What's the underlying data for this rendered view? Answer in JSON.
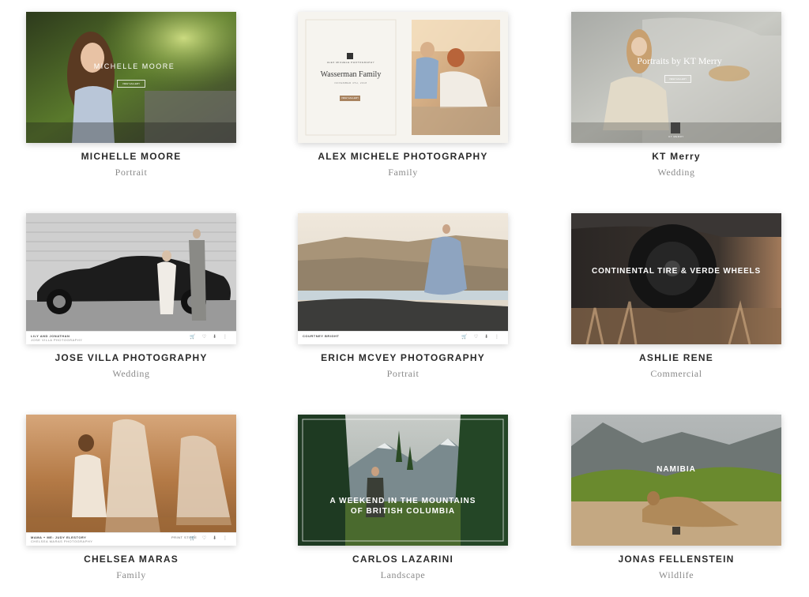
{
  "portfolios": [
    {
      "name": "MICHELLE MOORE",
      "category": "Portrait",
      "overlay_title": "MICHELLE MOORE",
      "overlay_button": "VIEW GALLERY"
    },
    {
      "name": "ALEX MICHELE PHOTOGRAPHY",
      "category": "Family",
      "overlay_brand": "ALEX MICHELE PHOTOGRAPHY",
      "overlay_title": "Wasserman Family",
      "overlay_date": "NOVEMBER 4TH, 2018",
      "overlay_button": "VIEW GALLERY"
    },
    {
      "name": "KT Merry",
      "category": "Wedding",
      "overlay_title": "Portraits by KT Merry",
      "overlay_button": "VIEW GALLERY",
      "overlay_brand": "KT MERRY"
    },
    {
      "name": "JOSE VILLA PHOTOGRAPHY",
      "category": "Wedding",
      "bar_title": "LILY AND JONATHAN",
      "bar_subtitle": "JOSE VILLA PHOTOGRAPHY"
    },
    {
      "name": "ERICH MCVEY PHOTOGRAPHY",
      "category": "Portrait",
      "bar_title": "COURTNEY BRIGHT"
    },
    {
      "name": "ASHLIE RENE",
      "category": "Commercial",
      "overlay_title": "CONTINENTAL TIRE & VERDE WHEELS"
    },
    {
      "name": "CHELSEA MARAS",
      "category": "Family",
      "bar_title": "MAMA + ME: JUDY ELESTORY",
      "bar_subtitle": "CHELSEA MARAS PHOTOGRAPHY",
      "bar_right": "PRINT STORE"
    },
    {
      "name": "CARLOS LAZARINI",
      "category": "Landscape",
      "overlay_title_line1": "A WEEKEND IN THE MOUNTAINS",
      "overlay_title_line2": "OF BRITISH COLUMBIA"
    },
    {
      "name": "JONAS FELLENSTEIN",
      "category": "Wildlife",
      "overlay_title": "NAMIBIA"
    }
  ],
  "colors": {
    "name_text": "#2a2a2a",
    "category_text": "#8a8a8a",
    "accent_brown": "#a8835f"
  },
  "icons": {
    "bar_icons": "🛒 ♡ ⬇ ⋮"
  }
}
